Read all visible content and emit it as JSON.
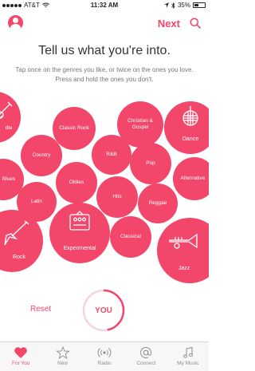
{
  "status_bar": {
    "carrier": "AT&T",
    "time": "11:32 AM",
    "battery": "35%",
    "signal_dots": 5
  },
  "nav": {
    "next_label": "Next"
  },
  "header": {
    "title": "Tell us what you're into.",
    "subtitle": "Tap once on the genres you like, or twice on the ones you love. Press and hold the ones you don't."
  },
  "genres": [
    {
      "label": "dle"
    },
    {
      "label": "Classic Rock"
    },
    {
      "label": "Christian & Gospel"
    },
    {
      "label": "Dance"
    },
    {
      "label": "Country"
    },
    {
      "label": "R&B"
    },
    {
      "label": "Pop"
    },
    {
      "label": "Alternative"
    },
    {
      "label": "Blues"
    },
    {
      "label": "Oldies"
    },
    {
      "label": "Hits"
    },
    {
      "label": "Latin"
    },
    {
      "label": "Reggae"
    },
    {
      "label": "Experimental"
    },
    {
      "label": "Classical"
    },
    {
      "label": "Rock"
    },
    {
      "label": "Jazz"
    }
  ],
  "controls": {
    "reset_label": "Reset",
    "you_label": "YOU"
  },
  "tabs": [
    {
      "label": "For You",
      "icon": "heart-icon",
      "active": true
    },
    {
      "label": "New",
      "icon": "star-icon",
      "active": false
    },
    {
      "label": "Radio",
      "icon": "radio-icon",
      "active": false
    },
    {
      "label": "Connect",
      "icon": "at-icon",
      "active": false
    },
    {
      "label": "My Music",
      "icon": "music-note-icon",
      "active": false
    }
  ],
  "colors": {
    "accent": "#f2476a"
  }
}
